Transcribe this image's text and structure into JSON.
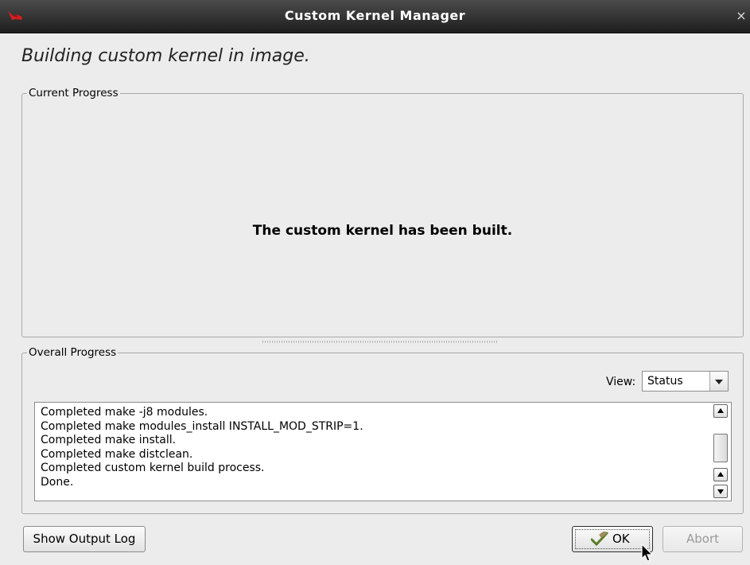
{
  "window": {
    "title": "Custom Kernel Manager",
    "close_glyph": "×"
  },
  "heading": "Building custom kernel in image.",
  "current_progress": {
    "legend": "Current Progress",
    "message": "The custom kernel has been built."
  },
  "overall_progress": {
    "legend": "Overall Progress",
    "view_label": "View:",
    "view_selected": "Status",
    "log_lines": [
      "Completed make -j8 modules.",
      "Completed make modules_install INSTALL_MOD_STRIP=1.",
      "Completed make install.",
      "Completed make distclean.",
      "Completed custom kernel build process.",
      "Done."
    ]
  },
  "buttons": {
    "show_log": "Show Output Log",
    "ok": "OK",
    "abort": "Abort"
  },
  "icons": {
    "app": "app-logo-icon",
    "close": "close-icon",
    "ok": "checkmark-pencil-icon",
    "cursor": "mouse-pointer-icon"
  },
  "colors": {
    "titlebar": "#2a2a2a",
    "window_bg": "#ececec",
    "app_logo": "#d11f1f"
  }
}
